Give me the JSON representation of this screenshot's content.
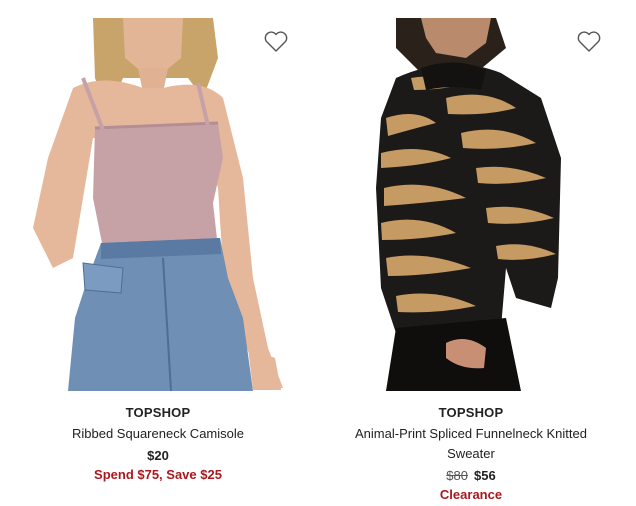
{
  "colors": {
    "promo": "#a8191e",
    "text": "#222222"
  },
  "products": [
    {
      "brand": "TOPSHOP",
      "name": "Ribbed Squareneck Camisole",
      "price": "$20",
      "promo": "Spend $75, Save $25",
      "favorite_icon": "heart-outline-icon"
    },
    {
      "brand": "TOPSHOP",
      "name_line1": "Animal-Print Spliced Funnelneck Knitted",
      "name_line2": "Sweater",
      "was_price": "$80",
      "price": "$56",
      "promo": "Clearance",
      "favorite_icon": "heart-outline-icon"
    }
  ]
}
